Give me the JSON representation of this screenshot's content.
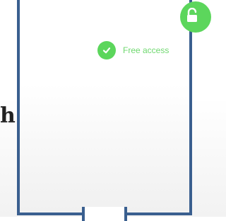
{
  "heading": {
    "fragment": "h"
  },
  "card": {
    "access_badge": {
      "label": "Free access",
      "icon": "checkmark-icon",
      "color": "#5cd65c"
    }
  },
  "corner_button": {
    "icon": "unlocked-padlock-icon",
    "color": "#5cd65c"
  },
  "colors": {
    "card_border": "#3a5f8f",
    "badge_text": "#6fd86f"
  }
}
